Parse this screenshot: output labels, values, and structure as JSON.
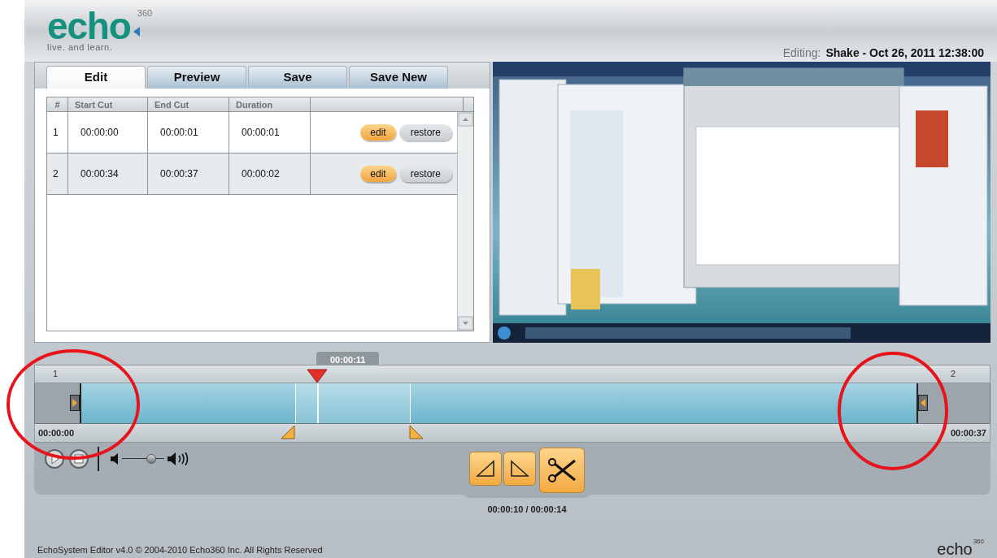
{
  "header": {
    "logo": {
      "wordmark": "echo",
      "superscript": "360",
      "tagline": "live. and learn."
    },
    "editing_label": "Editing:",
    "editing_title": "Shake - Oct 26, 2011 12:38:00"
  },
  "tabs": [
    {
      "label": "Edit",
      "selected": true
    },
    {
      "label": "Preview",
      "selected": false
    },
    {
      "label": "Save",
      "selected": false
    },
    {
      "label": "Save New",
      "selected": false
    }
  ],
  "cuts_table": {
    "columns": [
      "#",
      "Start Cut",
      "End Cut",
      "Duration"
    ],
    "rows": [
      {
        "index": "1",
        "start": "00:00:00",
        "end": "00:00:01",
        "duration": "00:00:01",
        "edit": "edit",
        "restore": "restore"
      },
      {
        "index": "2",
        "start": "00:00:34",
        "end": "00:00:37",
        "duration": "00:00:02",
        "edit": "edit",
        "restore": "restore"
      }
    ]
  },
  "timeline": {
    "segment_labels": [
      "1",
      "2"
    ],
    "playhead": {
      "time": "00:00:11",
      "level": 0.295
    },
    "start_time": "00:00:00",
    "end_time": "00:00:37"
  },
  "volume": {
    "level": 0.75
  },
  "selection_time": "00:00:10 / 00:00:14",
  "footer": {
    "text": "EchoSystem Editor v4.0 © 2004-2010 Echo360 Inc. All Rights Reserved",
    "logo": {
      "wordmark": "echo",
      "superscript": "360"
    }
  }
}
